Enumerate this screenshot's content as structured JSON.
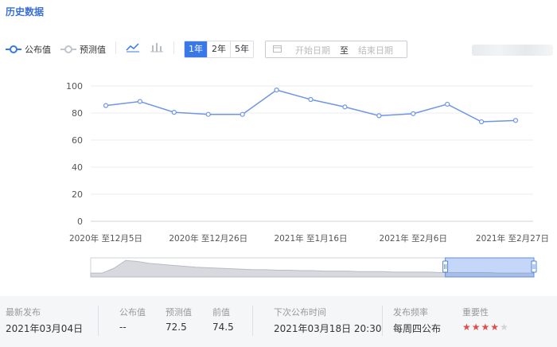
{
  "header": {
    "title": "历史数据"
  },
  "legend": [
    {
      "label": "公布值",
      "color": "#3a78e8"
    },
    {
      "label": "预测值",
      "color": "#c0c4cc"
    }
  ],
  "periods": {
    "items": [
      "1年",
      "2年",
      "5年"
    ],
    "active": "1年"
  },
  "date_range": {
    "start_placeholder": "开始日期",
    "separator": "至",
    "end_placeholder": "结束日期"
  },
  "colors": {
    "accent": "#3a78e8",
    "line": "#6e95e8",
    "stars": "#e14b4b"
  },
  "chart_data": {
    "type": "line",
    "x": [
      "2020年 至12月5日",
      "2020年 至12月12日",
      "2020年 至12月19日",
      "2020年 至12月26日",
      "2021年 至1月2日",
      "2021年 至1月9日",
      "2021年 至1月16日",
      "2021年 至1月23日",
      "2021年 至1月30日",
      "2021年 至2月6日",
      "2021年 至2月13日",
      "2021年 至2月20日",
      "2021年 至2月27日"
    ],
    "xticks_shown": [
      "2020年 至12月5日",
      "2020年 至12月26日",
      "2021年 至1月16日",
      "2021年 至2月6日",
      "2021年 至2月27日"
    ],
    "series": [
      {
        "name": "公布值",
        "values": [
          85.5,
          88.5,
          80.5,
          79,
          79,
          97,
          90,
          84.5,
          78,
          79.5,
          86.5,
          73.5,
          74.5
        ]
      }
    ],
    "yticks": [
      0,
      20,
      40,
      60,
      80,
      100
    ],
    "ylim": [
      0,
      100
    ],
    "grid": true,
    "navigator_series": [
      8,
      8,
      18,
      34,
      32,
      28,
      26,
      24,
      22,
      20,
      19,
      18,
      17,
      16,
      15,
      15,
      14,
      14,
      13,
      13,
      12,
      12,
      12,
      11,
      11,
      11,
      10,
      10,
      10,
      10,
      9,
      9,
      9,
      9,
      9,
      8,
      8,
      8,
      8
    ],
    "navigator_selection": [
      0.8,
      1.0
    ]
  },
  "footer": {
    "latest_release": {
      "label": "最新发布",
      "value": "2021年03月04日"
    },
    "actual": {
      "label": "公布值",
      "value": "--"
    },
    "forecast": {
      "label": "预测值",
      "value": "72.5"
    },
    "previous": {
      "label": "前值",
      "value": "74.5"
    },
    "next_release": {
      "label": "下次公布时间",
      "value": "2021年03月18日 20:30"
    },
    "frequency": {
      "label": "发布频率",
      "value": "每周四公布"
    },
    "importance": {
      "label": "重要性",
      "stars_filled": 4,
      "stars_total": 5
    }
  }
}
